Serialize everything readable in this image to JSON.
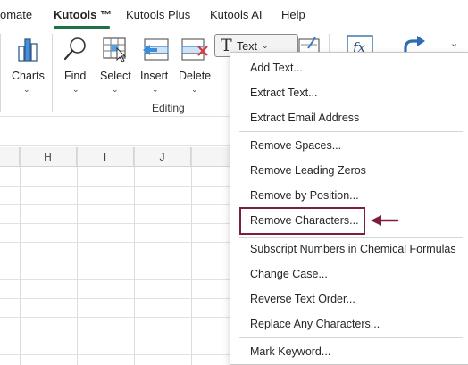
{
  "menubar": {
    "tabs": [
      {
        "label": "omate"
      },
      {
        "label": "Kutools ™"
      },
      {
        "label": "Kutools Plus"
      },
      {
        "label": "Kutools AI"
      },
      {
        "label": "Help"
      }
    ],
    "active_tab": "Kutools ™",
    "accent_color": "#1e7145"
  },
  "ribbon": {
    "buttons": [
      {
        "label": "Charts",
        "icon": "bar-chart-icon"
      },
      {
        "label": "Find",
        "icon": "magnifier-icon"
      },
      {
        "label": "Select",
        "icon": "select-cells-icon"
      },
      {
        "label": "Insert",
        "icon": "insert-rows-icon"
      },
      {
        "label": "Delete",
        "icon": "delete-cells-icon"
      }
    ],
    "group_label": "Editing",
    "text_button": {
      "label": "Text",
      "icon": "text-t-icon"
    },
    "other_icons": [
      "format-icon",
      "fx-icon",
      "redo-arrow-icon"
    ]
  },
  "grid": {
    "columns": [
      "H",
      "I",
      "J"
    ]
  },
  "text_menu": {
    "items": [
      {
        "label": "Add Text..."
      },
      {
        "label": "Extract Text..."
      },
      {
        "label": "Extract Email Address"
      },
      {
        "label": "Remove Spaces..."
      },
      {
        "label": "Remove Leading Zeros"
      },
      {
        "label": "Remove by Position..."
      },
      {
        "label": "Remove Characters..."
      },
      {
        "label": "Subscript Numbers in Chemical Formulas"
      },
      {
        "label": "Change Case..."
      },
      {
        "label": "Reverse Text Order..."
      },
      {
        "label": "Replace Any Characters..."
      },
      {
        "label": "Mark Keyword..."
      }
    ],
    "highlighted_item": "Remove Characters...",
    "highlight_color": "#7b1f3a"
  }
}
